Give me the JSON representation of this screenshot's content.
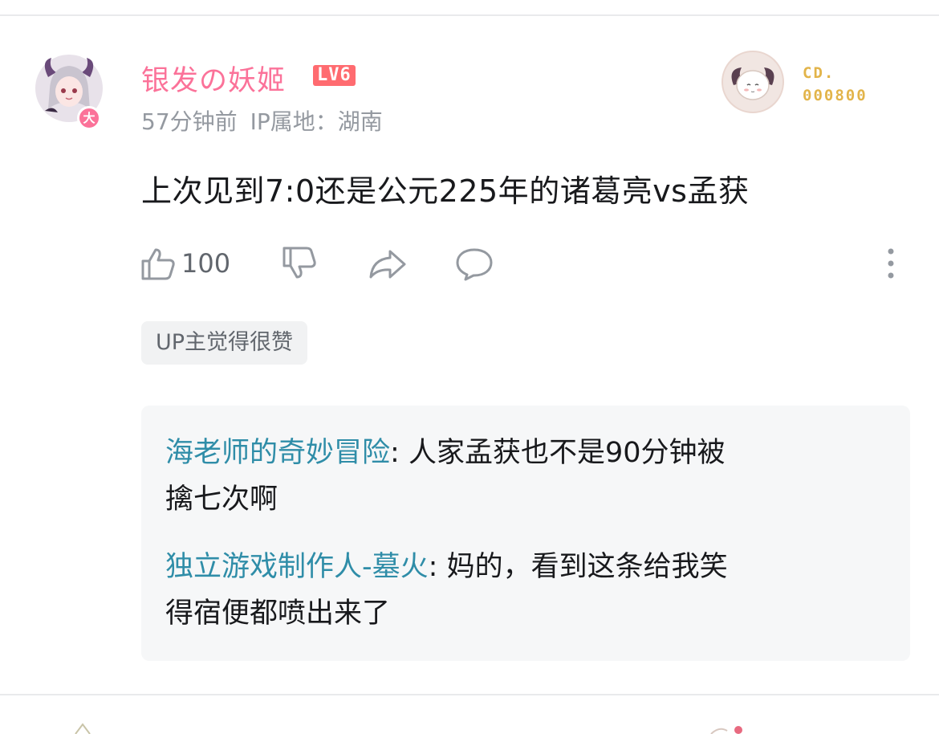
{
  "comment": {
    "username": "银发の妖姬",
    "level_badge": "LV6",
    "vip_badge": "大",
    "time": "57分钟前",
    "ip_location": "IP属地：湖南",
    "fan_badge": {
      "line1": "CD.",
      "line2": "000800"
    },
    "content": "上次见到7:0还是公元225年的诸葛亮vs孟获",
    "like_count": "100",
    "up_tag": "UP主觉得很赞"
  },
  "replies": [
    {
      "name": "海老师的奇妙冒险",
      "separator": ": ",
      "line1": "人家孟获也不是90分钟被",
      "line2": "擒七次啊"
    },
    {
      "name": "独立游戏制作人-墓火",
      "separator": ": ",
      "line1": "妈的，看到这条给我笑",
      "line2": "得宿便都喷出来了"
    }
  ],
  "icons": {
    "like": "thumbs-up-icon",
    "dislike": "thumbs-down-icon",
    "share": "share-arrow-icon",
    "reply": "comment-bubble-icon",
    "more": "more-vertical-icon"
  },
  "colors": {
    "username": "#fb7299",
    "level_badge": "#ff6b70",
    "reply_name": "#2f8da8",
    "meta": "#9499a0",
    "fan_badge_text": "#e2b44a"
  }
}
